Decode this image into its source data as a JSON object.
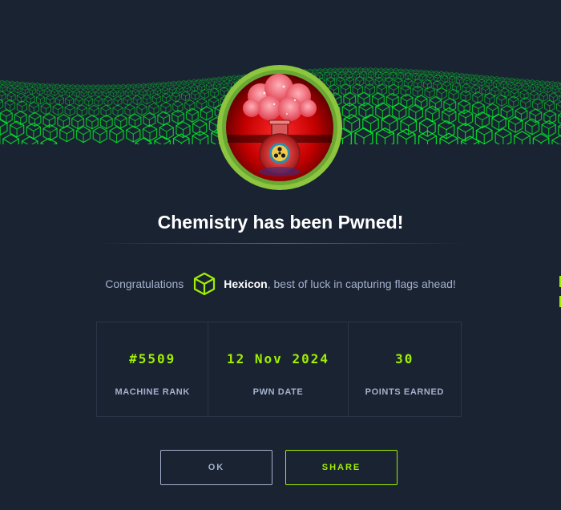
{
  "modal": {
    "title": "Chemistry has been Pwned!",
    "congrats_prefix": "Congratulations",
    "username": "Hexicon",
    "congrats_suffix": ", best of luck in capturing flags ahead!"
  },
  "stats": [
    {
      "value": "#5509",
      "label": "MACHINE RANK"
    },
    {
      "value": "12 Nov 2024",
      "label": "PWN DATE"
    },
    {
      "value": "30",
      "label": "POINTS EARNED"
    }
  ],
  "buttons": {
    "ok_label": "OK",
    "share_label": "SHARE"
  },
  "colors": {
    "background": "#1a2332",
    "accent": "#9fef00",
    "text_muted": "#a4b1cd",
    "border": "#2b3547"
  },
  "icons": {
    "banner": "green-hexagon-wave-banner",
    "badge": "chemistry-flask-machine-avatar",
    "user": "hexagon-cube-icon"
  }
}
